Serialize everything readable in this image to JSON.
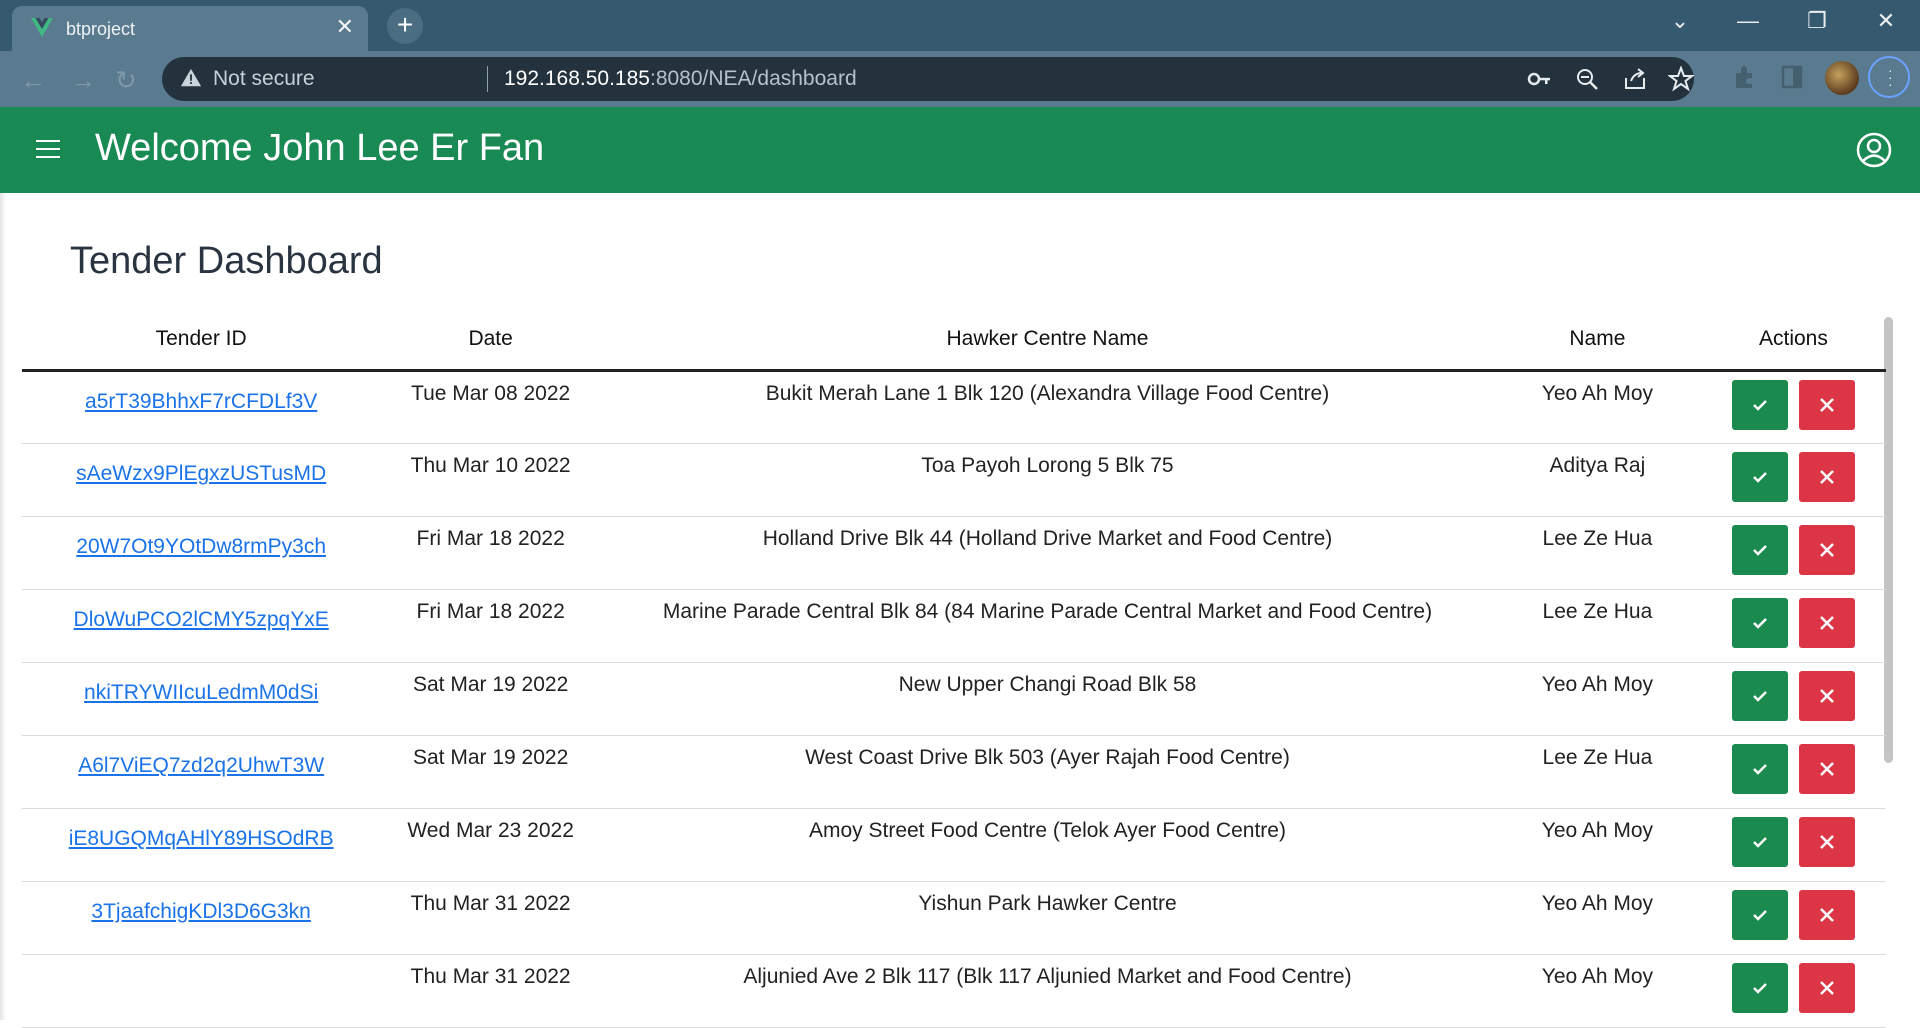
{
  "browser": {
    "tab_title": "btproject",
    "tab_close": "✕",
    "new_tab": "+",
    "security_label": "Not secure",
    "url_host": "192.168.50.185",
    "url_path": ":8080/NEA/dashboard",
    "icons": [
      "vue-favicon-icon",
      "back-icon",
      "forward-icon",
      "reload-icon",
      "warning-icon",
      "key-icon",
      "zoom-out-icon",
      "share-icon",
      "star-icon",
      "extensions-icon",
      "sidebar-icon",
      "profile-avatar",
      "menu-icon",
      "tab-search-icon",
      "minimize-icon",
      "restore-icon",
      "close-window-icon"
    ]
  },
  "header": {
    "welcome": "Welcome John Lee Er Fan"
  },
  "page": {
    "title": "Tender Dashboard"
  },
  "table": {
    "columns": [
      "Tender ID",
      "Date",
      "Hawker Centre Name",
      "Name",
      "Actions"
    ],
    "rows": [
      {
        "id": "a5rT39BhhxF7rCFDLf3V",
        "date": "Tue Mar 08 2022",
        "centre": "Bukit Merah Lane 1 Blk 120 (Alexandra Village Food Centre)",
        "name": "Yeo Ah Moy"
      },
      {
        "id": "sAeWzx9PlEgxzUSTusMD",
        "date": "Thu Mar 10 2022",
        "centre": "Toa Payoh Lorong 5 Blk 75",
        "name": "Aditya Raj"
      },
      {
        "id": "20W7Ot9YOtDw8rmPy3ch",
        "date": "Fri Mar 18 2022",
        "centre": "Holland Drive Blk 44 (Holland Drive Market and Food Centre)",
        "name": "Lee Ze Hua"
      },
      {
        "id": "DloWuPCO2lCMY5zpqYxE",
        "date": "Fri Mar 18 2022",
        "centre": "Marine Parade Central Blk 84 (84 Marine Parade Central Market and Food Centre)",
        "name": "Lee Ze Hua"
      },
      {
        "id": "nkiTRYWIIcuLedmM0dSi",
        "date": "Sat Mar 19 2022",
        "centre": "New Upper Changi Road Blk 58",
        "name": "Yeo Ah Moy"
      },
      {
        "id": "A6l7ViEQ7zd2q2UhwT3W",
        "date": "Sat Mar 19 2022",
        "centre": "West Coast Drive Blk 503 (Ayer Rajah Food Centre)",
        "name": "Lee Ze Hua"
      },
      {
        "id": "iE8UGQMqAHlY89HSOdRB",
        "date": "Wed Mar 23 2022",
        "centre": "Amoy Street Food Centre (Telok Ayer Food Centre)",
        "name": "Yeo Ah Moy"
      },
      {
        "id": "3TjaafchigKDl3D6G3kn",
        "date": "Thu Mar 31 2022",
        "centre": "Yishun Park Hawker Centre",
        "name": "Yeo Ah Moy"
      },
      {
        "id": "",
        "date": "Thu Mar 31 2022",
        "centre": "Aljunied Ave 2 Blk 117 (Blk 117 Aljunied Market and Food Centre)",
        "name": "Yeo Ah Moy"
      }
    ]
  },
  "colors": {
    "appbar": "#1a8a55",
    "approve": "#1a8a4f",
    "reject": "#dc3545",
    "link": "#1a73e8"
  }
}
